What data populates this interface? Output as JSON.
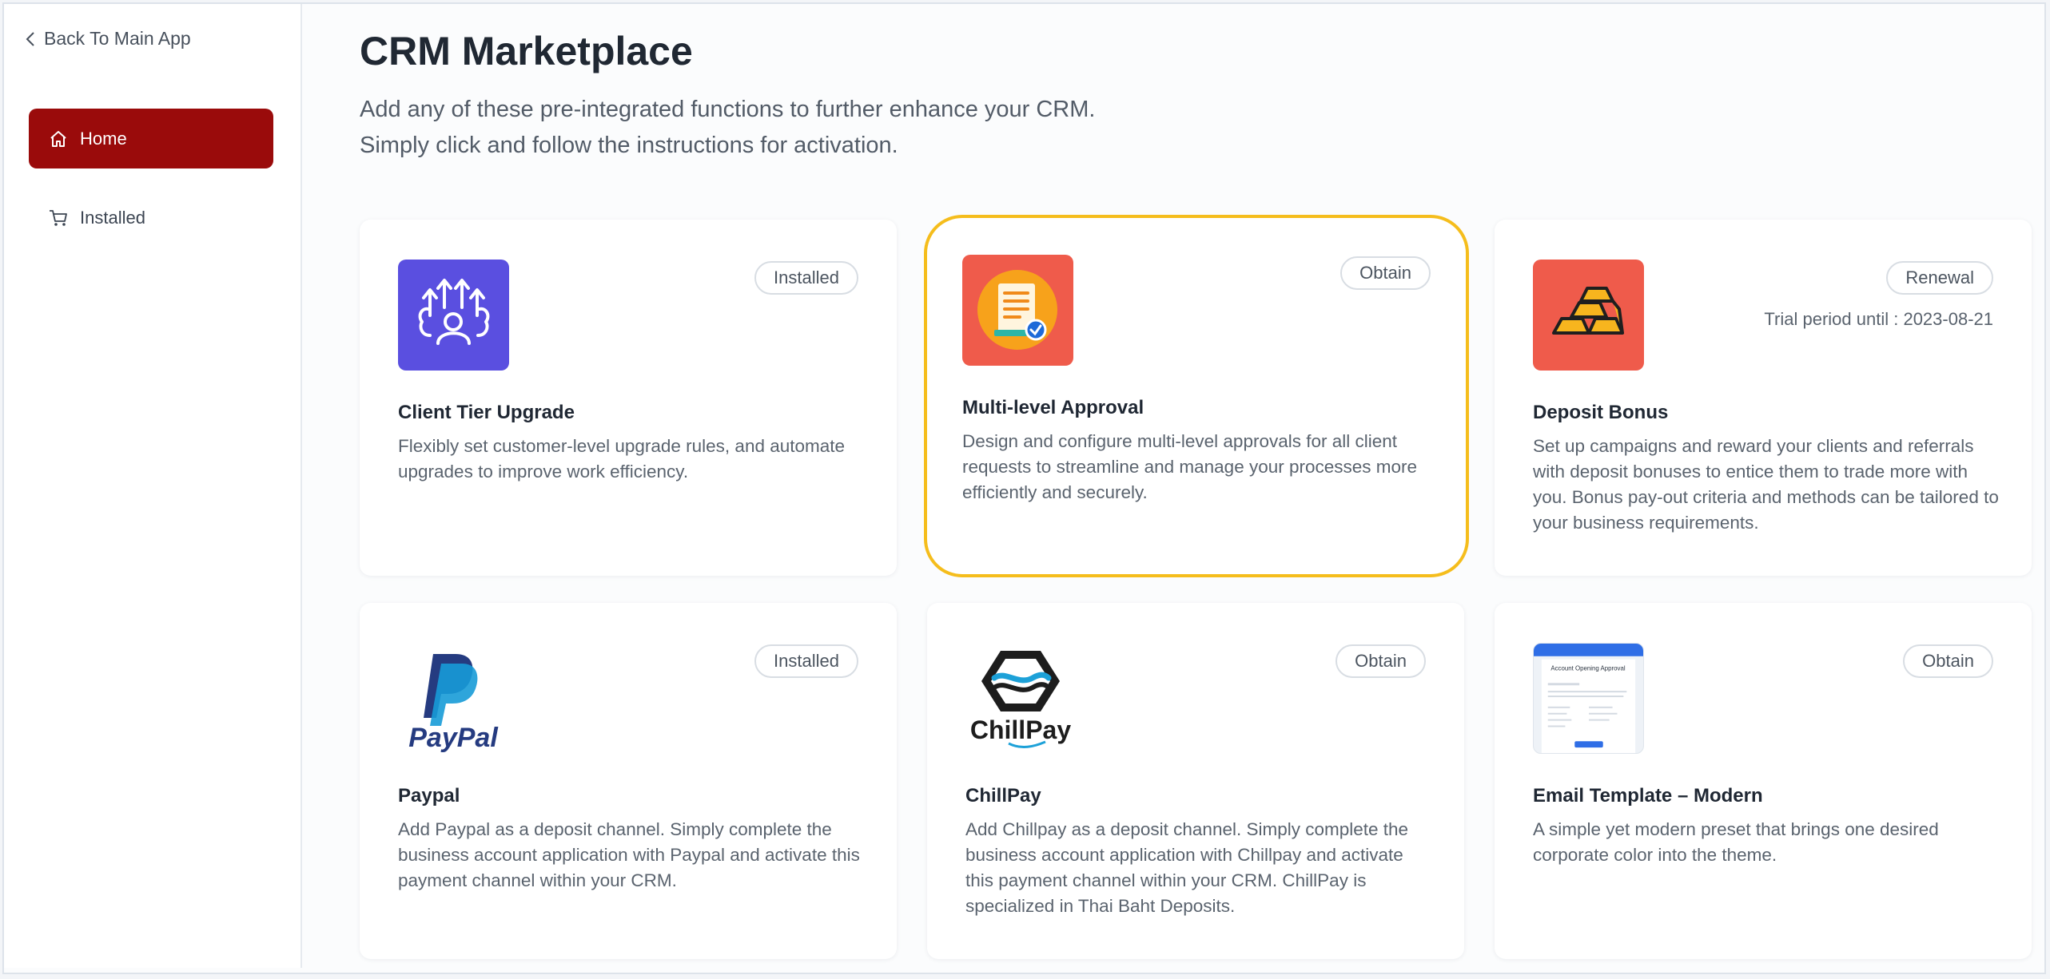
{
  "sidebar": {
    "back_label": "Back To Main App",
    "items": [
      {
        "label": "Home",
        "icon": "home-icon",
        "active": true
      },
      {
        "label": "Installed",
        "icon": "cart-icon",
        "active": false
      }
    ]
  },
  "main": {
    "title": "CRM Marketplace",
    "subtitle_lines": [
      "Add any of these pre-integrated functions to further enhance your CRM.",
      "Simply click and follow the instructions for activation."
    ],
    "cards": [
      {
        "name": "Client Tier Upgrade",
        "badge": "Installed",
        "description": "Flexibly set customer-level upgrade rules, and automate upgrades to improve work efficiency.",
        "icon": "tier-upgrade-icon"
      },
      {
        "name": "Multi-level Approval",
        "badge": "Obtain",
        "description": "Design and configure multi-level approvals for all client requests to streamline and manage your processes more efficiently and securely.",
        "icon": "approval-document-icon",
        "highlighted": true
      },
      {
        "name": "Deposit Bonus",
        "badge": "Renewal",
        "trial": "Trial period until : 2023-08-21",
        "description": "Set up campaigns and reward your clients and referrals with deposit bonuses to entice them to trade more with you. Bonus pay-out criteria and methods can be tailored to your business requirements.",
        "icon": "gold-bars-icon"
      },
      {
        "name": "Paypal",
        "badge": "Installed",
        "description": "Add Paypal as a deposit channel. Simply complete the business account application with Paypal and activate this payment channel within your CRM.",
        "icon": "paypal-logo",
        "logo_text": "PayPal"
      },
      {
        "name": "ChillPay",
        "badge": "Obtain",
        "description": "Add Chillpay as a deposit channel. Simply complete the business account application with Chillpay and activate this payment channel within your CRM. ChillPay is specialized in Thai Baht Deposits.",
        "icon": "chillpay-logo",
        "logo_text": "ChillPay"
      },
      {
        "name": "Email Template – Modern",
        "badge": "Obtain",
        "description": "A simple yet modern preset that brings one desired corporate color into the theme.",
        "icon": "email-template-preview-icon",
        "preview_title": "Account Opening Approval"
      }
    ]
  },
  "colors": {
    "accent": "#9a0b0b",
    "highlight_border": "#f5bd1c",
    "tier_icon_bg": "#5a4fe0",
    "coral_icon_bg": "#ef5b4b",
    "paypal_dark": "#253b80",
    "paypal_light": "#179bd7"
  }
}
